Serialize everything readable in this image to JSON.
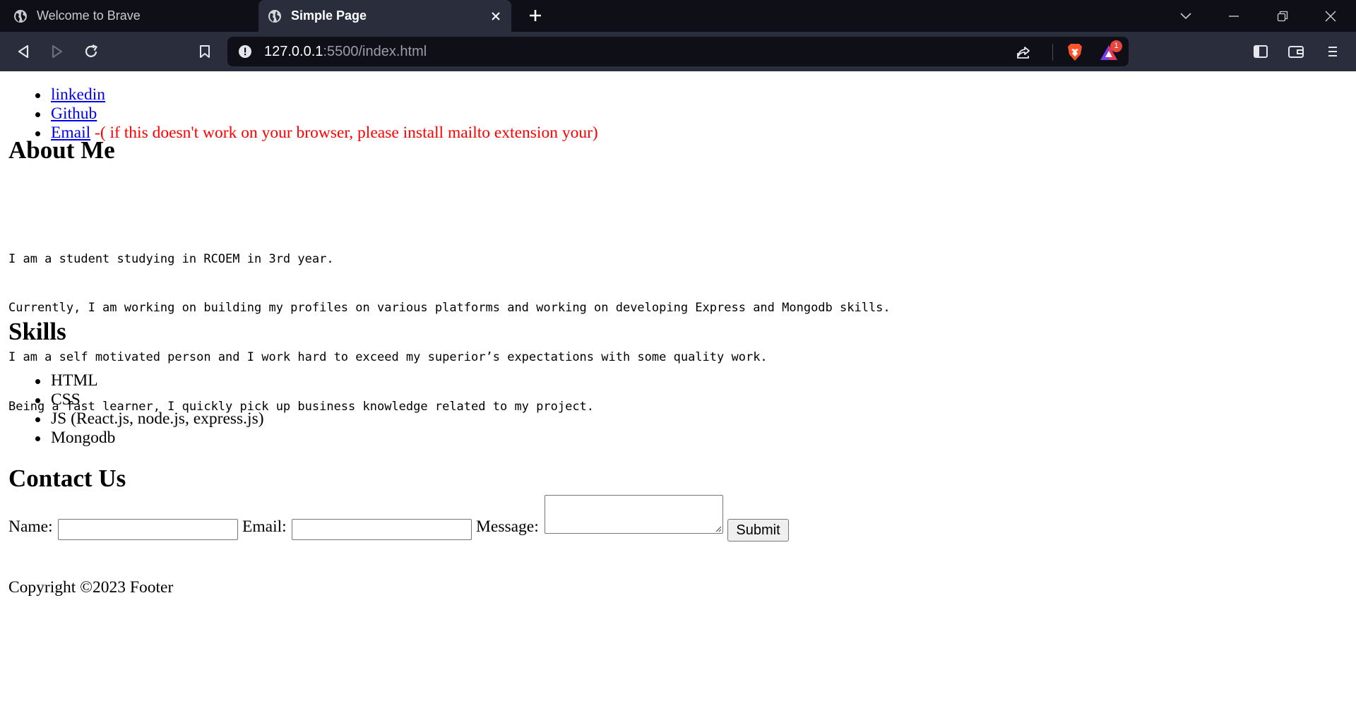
{
  "browser": {
    "tabs": [
      {
        "title": "Welcome to Brave",
        "active": false
      },
      {
        "title": "Simple Page",
        "active": true
      }
    ],
    "url": {
      "host": "127.0.0.1",
      "rest": ":5500/index.html"
    },
    "rewards_badge": "1",
    "colors": {
      "frame": "#0e0f17",
      "toolbar": "#2a2d3b",
      "brave_orange": "#fb542b"
    }
  },
  "page": {
    "links": [
      {
        "label": "linkedin"
      },
      {
        "label": "Github"
      },
      {
        "label": "Email",
        "note": "-( if this doesn't work on your browser, please install mailto extension your)"
      }
    ],
    "about": {
      "heading": "About Me",
      "lines": [
        "I am a student studying in RCOEM in 3rd year.",
        "Currently, I am working on building my profiles on various platforms and working on developing Express and Mongodb skills.",
        "I am a self motivated person and I work hard to exceed my superior’s expectations with some quality work.",
        "Being a fast learner, I quickly pick up business knowledge related to my project."
      ]
    },
    "skills": {
      "heading": "Skills",
      "items": [
        "HTML",
        "CSS",
        "JS (React.js, node.js, express.js)",
        "Mongodb"
      ]
    },
    "contact": {
      "heading": "Contact Us",
      "name_label": "Name:",
      "name_value": "",
      "email_label": "Email:",
      "email_value": "",
      "message_label": "Message:",
      "message_value": "",
      "submit_label": "Submit"
    },
    "footer": "Copyright ©2023 Footer"
  }
}
